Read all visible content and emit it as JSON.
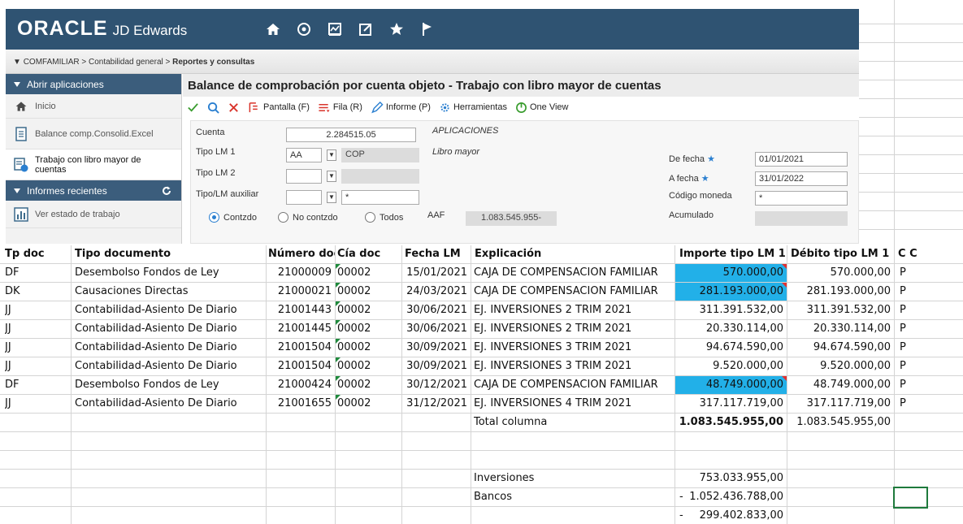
{
  "app": {
    "logo_brand": "ORACLE",
    "logo_product": "JD Edwards",
    "breadcrumb": {
      "arrow": "▼",
      "root": "COMFAMILIAR",
      "sep1": ">",
      "level1": "Contabilidad general",
      "sep2": ">",
      "current": "Reportes y consultas"
    }
  },
  "sidebar": {
    "open_apps_label": "Abrir aplicaciones",
    "items": [
      {
        "label": "Inicio",
        "icon": "home-icon"
      },
      {
        "label": "Balance comp.Consolid.Excel",
        "icon": "document-icon"
      },
      {
        "label": "Trabajo con libro mayor de cuentas",
        "icon": "app-icon",
        "active": true
      }
    ],
    "recent_label": "Informes recientes",
    "recent_items": [
      {
        "label": "Ver estado de trabajo",
        "icon": "report-icon"
      }
    ]
  },
  "form": {
    "title": "Balance de comprobación por cuenta objeto - Trabajo con libro mayor de cuentas",
    "toolbar": {
      "pantalla": "Pantalla (F)",
      "fila": "Fila (R)",
      "informe": "Informe (P)",
      "herramientas": "Herramientas",
      "oneview": "One View"
    },
    "cuenta_label": "Cuenta",
    "cuenta_value": "2.284515.05",
    "cuenta_desc": "APLICACIONES",
    "tipo_lm1_label": "Tipo LM 1",
    "tipo_lm1_value": "AA",
    "tipo_lm1_currency": "COP",
    "tipo_lm1_desc": "Libro mayor",
    "tipo_lm2_label": "Tipo LM 2",
    "tipo_lm_aux_label": "Tipo/LM auxiliar",
    "tipo_lm_aux_value": "*",
    "de_fecha_label": "De fecha",
    "de_fecha_value": "01/01/2021",
    "a_fecha_label": "A fecha",
    "a_fecha_value": "31/01/2022",
    "codigo_moneda_label": "Código moneda",
    "codigo_moneda_value": "*",
    "acumulado_label": "Acumulado",
    "radio_contzdo": "Contzdo",
    "radio_no_contzdo": "No contzdo",
    "radio_todos": "Todos",
    "aaf_label": "AAF",
    "aaf_value": "1.083.545.955-"
  },
  "sheet": {
    "headers": {
      "tp_doc": "Tp doc",
      "tipo_documento": "Tipo documento",
      "numero_doc": "Número doc",
      "cia_doc": "Cía doc",
      "fecha_lm": "Fecha LM",
      "explicacion": "Explicación",
      "importe": "Importe tipo LM 1",
      "debito": "Débito tipo LM 1",
      "cc": "C C"
    },
    "rows": [
      {
        "tp": "DF",
        "tipo": "Desembolso Fondos de Ley",
        "num": "21000009",
        "cia": "00002",
        "fecha": "15/01/2021",
        "expl": "CAJA DE COMPENSACION FAMILIAR",
        "importe": "570.000,00",
        "debito": "570.000,00",
        "cc": "P",
        "hl": true
      },
      {
        "tp": "DK",
        "tipo": "Causaciones Directas",
        "num": "21000021",
        "cia": "00002",
        "fecha": "24/03/2021",
        "expl": "CAJA DE COMPENSACION FAMILIAR",
        "importe": "281.193.000,00",
        "debito": "281.193.000,00",
        "cc": "P",
        "hl": true
      },
      {
        "tp": "JJ",
        "tipo": "Contabilidad-Asiento De Diario",
        "num": "21001443",
        "cia": "00002",
        "fecha": "30/06/2021",
        "expl": "EJ. INVERSIONES 2 TRIM 2021",
        "importe": "311.391.532,00",
        "debito": "311.391.532,00",
        "cc": "P",
        "hl": false
      },
      {
        "tp": "JJ",
        "tipo": "Contabilidad-Asiento De Diario",
        "num": "21001445",
        "cia": "00002",
        "fecha": "30/06/2021",
        "expl": "EJ. INVERSIONES 2 TRIM 2021",
        "importe": "20.330.114,00",
        "debito": "20.330.114,00",
        "cc": "P",
        "hl": false
      },
      {
        "tp": "JJ",
        "tipo": "Contabilidad-Asiento De Diario",
        "num": "21001504",
        "cia": "00002",
        "fecha": "30/09/2021",
        "expl": "EJ. INVERSIONES 3 TRIM 2021",
        "importe": "94.674.590,00",
        "debito": "94.674.590,00",
        "cc": "P",
        "hl": false
      },
      {
        "tp": "JJ",
        "tipo": "Contabilidad-Asiento De Diario",
        "num": "21001504",
        "cia": "00002",
        "fecha": "30/09/2021",
        "expl": "EJ. INVERSIONES 3 TRIM 2021",
        "importe": "9.520.000,00",
        "debito": "9.520.000,00",
        "cc": "P",
        "hl": false
      },
      {
        "tp": "DF",
        "tipo": "Desembolso Fondos de Ley",
        "num": "21000424",
        "cia": "00002",
        "fecha": "30/12/2021",
        "expl": "CAJA DE COMPENSACION FAMILIAR",
        "importe": "48.749.000,00",
        "debito": "48.749.000,00",
        "cc": "P",
        "hl": true
      },
      {
        "tp": "JJ",
        "tipo": "Contabilidad-Asiento De Diario",
        "num": "21001655",
        "cia": "00002",
        "fecha": "31/12/2021",
        "expl": "EJ. INVERSIONES 4 TRIM 2021",
        "importe": "317.117.719,00",
        "debito": "317.117.719,00",
        "cc": "P",
        "hl": false
      }
    ],
    "total_label": "Total columna",
    "total_importe": "1.083.545.955,00",
    "total_debito": "1.083.545.955,00",
    "inversiones_label": "Inversiones",
    "inversiones_value": "753.033.955,00",
    "bancos_label": "Bancos",
    "bancos_sign": "-",
    "bancos_value": "1.052.436.788,00",
    "diff_sign": "-",
    "diff_value": "299.402.833,00"
  },
  "colors": {
    "jde_header": "#2f5372",
    "sidebar_header": "#3b5d7c",
    "cell_highlight": "#22b0e8",
    "selection": "#1e7a3c"
  }
}
